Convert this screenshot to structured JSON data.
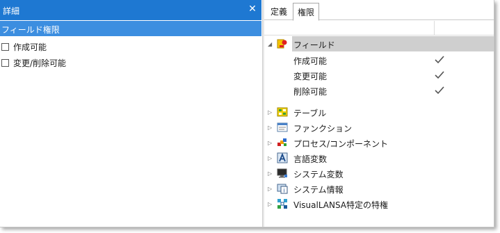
{
  "left_panel": {
    "title": "詳細",
    "close_glyph": "✕",
    "subheader": "フィールド権限",
    "permissions": [
      {
        "label": "作成可能",
        "checked": false
      },
      {
        "label": "変更/削除可能",
        "checked": false
      }
    ]
  },
  "right_panel": {
    "tabs": [
      {
        "label": "定義",
        "active": false
      },
      {
        "label": "権限",
        "active": true
      }
    ],
    "tree": {
      "field": {
        "label": "フィールド",
        "expanded": true,
        "icon": "field-icon",
        "children": [
          {
            "label": "作成可能",
            "checked": true
          },
          {
            "label": "変更可能",
            "checked": true
          },
          {
            "label": "削除可能",
            "checked": true
          }
        ]
      },
      "items": [
        {
          "label": "テーブル",
          "icon": "table-icon"
        },
        {
          "label": "ファンクション",
          "icon": "function-icon"
        },
        {
          "label": "プロセス/コンポーネント",
          "icon": "process-component-icon"
        },
        {
          "label": "言語変数",
          "icon": "language-variable-icon"
        },
        {
          "label": "システム変数",
          "icon": "system-variable-icon"
        },
        {
          "label": "システム情報",
          "icon": "system-info-icon"
        },
        {
          "label": "VisualLANSA特定の特権",
          "icon": "visuallansa-privilege-icon"
        }
      ]
    }
  },
  "colors": {
    "header_blue": "#1e78d2",
    "subheader_blue": "#3c8ee0",
    "selection_gray": "#cfcfcf"
  }
}
